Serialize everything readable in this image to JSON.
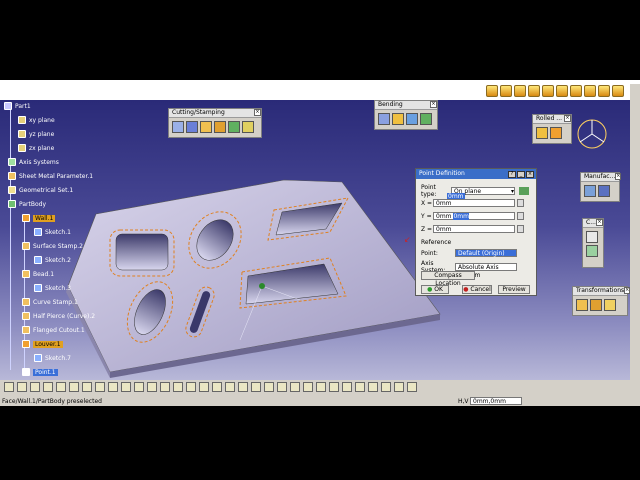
{
  "tree": {
    "items": [
      {
        "label": "Part1"
      },
      {
        "label": "xy plane"
      },
      {
        "label": "yz plane"
      },
      {
        "label": "zx plane"
      },
      {
        "label": "Axis Systems"
      },
      {
        "label": "Sheet Metal Parameter.1"
      },
      {
        "label": "Geometrical Set.1"
      },
      {
        "label": "PartBody"
      },
      {
        "label": "Wall.1"
      },
      {
        "label": "Sketch.1"
      },
      {
        "label": "Surface Stamp.2"
      },
      {
        "label": "Sketch.2"
      },
      {
        "label": "Bead.1"
      },
      {
        "label": "Sketch.3"
      },
      {
        "label": "Curve Stamp.1"
      },
      {
        "label": "Half Pierce (Curve).2"
      },
      {
        "label": "Flanged Cutout.1"
      },
      {
        "label": "Louver.1"
      },
      {
        "label": "Sketch.7"
      },
      {
        "label": "Point.1"
      }
    ]
  },
  "toolbars": {
    "cutting": "Cutting/Stamping",
    "bending": "Bending",
    "rolled": "Rolled ...",
    "manufacturing": "Manufac...",
    "c": "C...",
    "transformations": "Transformations"
  },
  "dialog": {
    "title": "Point Definition",
    "point_type_label": "Point type:",
    "point_type_value": "On plane",
    "x_label": "X =",
    "x_value": "0mm",
    "y_label": "Y =",
    "y_value": "0mm",
    "z_label": "Z =",
    "z_value": "0mm",
    "tooltip": "0mm",
    "reference_label": "Reference",
    "point_label": "Point:",
    "point_value": "Default (Origin)",
    "axis_label": "Axis System:",
    "axis_value": "Absolute Axis System",
    "compass_button": "Compass Location",
    "ok_button": "OK",
    "cancel_button": "Cancel",
    "preview_button": "Preview"
  },
  "status": {
    "text": "Face/Wall.1/PartBody preselected",
    "hv_label": "H,V",
    "hv_value": "0mm,0mm"
  }
}
